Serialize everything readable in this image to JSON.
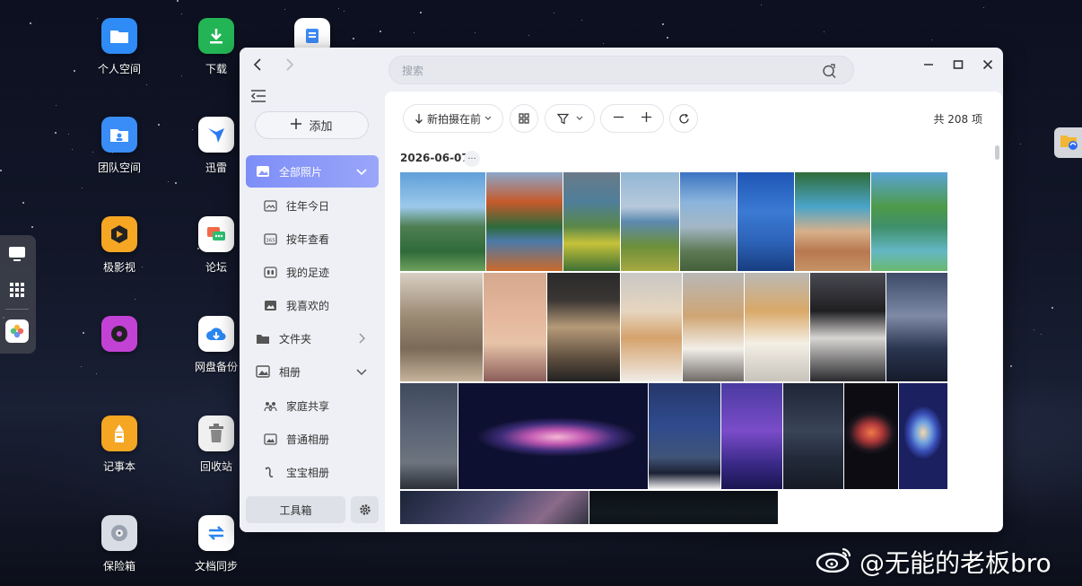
{
  "desktop": {
    "icons": [
      {
        "label": "个人空间",
        "icon": "folder-icon",
        "color": "#2f8bf5"
      },
      {
        "label": "下载",
        "icon": "download-icon",
        "color": "#22b455"
      },
      {
        "label": "",
        "icon": "notes-app-icon",
        "color": "#3d8cf6"
      },
      {
        "label": "团队空间",
        "icon": "team-folder-icon",
        "color": "#3a8df6"
      },
      {
        "label": "迅雷",
        "icon": "thunder-icon",
        "color": "#ffffff"
      },
      {
        "label": "极影视",
        "icon": "video-icon",
        "color": "#f5a623"
      },
      {
        "label": "论坛",
        "icon": "forum-icon",
        "color": "#ffffff"
      },
      {
        "label": "",
        "icon": "music-icon",
        "color": "#c342d6"
      },
      {
        "label": "网盘备份",
        "icon": "cloud-backup-icon",
        "color": "#ffffff"
      },
      {
        "label": "记事本",
        "icon": "notepad-icon",
        "color": "#f5a623"
      },
      {
        "label": "回收站",
        "icon": "trash-icon",
        "color": "#f0f0f0"
      },
      {
        "label": "保险箱",
        "icon": "safe-icon",
        "color": "#d8dce4"
      },
      {
        "label": "文档同步",
        "icon": "sync-icon",
        "color": "#ffffff"
      }
    ]
  },
  "dock": {
    "items": [
      "desktop-icon",
      "apps-grid-icon",
      "photos-app-icon"
    ]
  },
  "window": {
    "sidebar": {
      "add_label": "添加",
      "items": [
        {
          "label": "全部照片",
          "icon": "photo-icon",
          "active": true
        },
        {
          "label": "往年今日",
          "icon": "history-icon"
        },
        {
          "label": "按年查看",
          "icon": "calendar-365-icon"
        },
        {
          "label": "我的足迹",
          "icon": "footprint-icon"
        },
        {
          "label": "我喜欢的",
          "icon": "favorite-icon"
        },
        {
          "label": "文件夹",
          "icon": "folder-icon"
        },
        {
          "label": "相册",
          "icon": "album-icon"
        },
        {
          "label": "家庭共享",
          "icon": "family-icon"
        },
        {
          "label": "普通相册",
          "icon": "album-icon"
        },
        {
          "label": "宝宝相册",
          "icon": "baby-icon"
        }
      ],
      "toolbox_label": "工具箱"
    },
    "search": {
      "placeholder": "搜索"
    },
    "toolbar": {
      "sort_label": "新拍摄在前",
      "count_label": "共 208 项"
    },
    "section": {
      "date": "2026-06-07",
      "more": "···"
    }
  },
  "watermark": {
    "text": "@无能的老板bro"
  }
}
